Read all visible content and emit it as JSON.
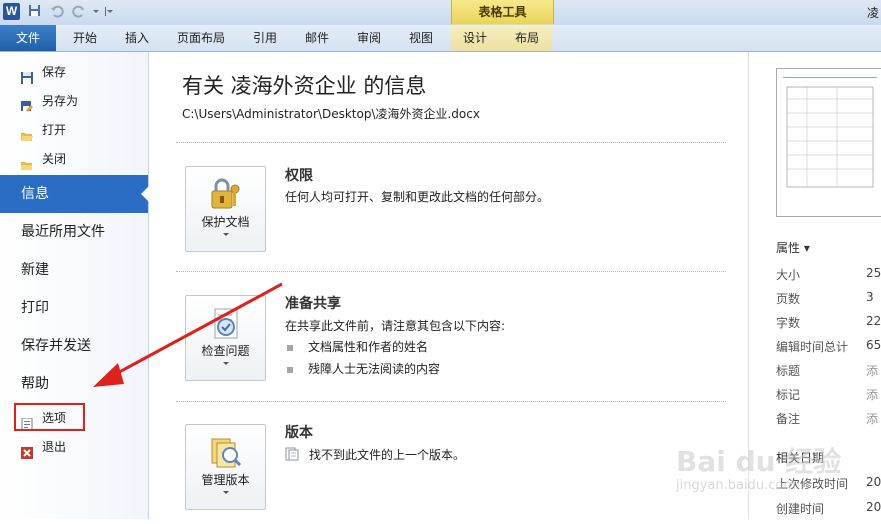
{
  "titlebar": {
    "logo": "W",
    "right_text": "凌",
    "context_group": "表格工具"
  },
  "tabs": [
    "文件",
    "开始",
    "插入",
    "页面布局",
    "引用",
    "邮件",
    "审阅",
    "视图",
    "设计",
    "布局"
  ],
  "nav": {
    "save": "保存",
    "save_as": "另存为",
    "open": "打开",
    "close": "关闭",
    "info": "信息",
    "recent": "最近所用文件",
    "new": "新建",
    "print": "打印",
    "save_send": "保存并发送",
    "help": "帮助",
    "options": "选项",
    "exit": "退出"
  },
  "main": {
    "title": "有关 凌海外资企业 的信息",
    "path": "C:\\Users\\Administrator\\Desktop\\凌海外资企业.docx",
    "permissions": {
      "button": "保护文档",
      "title": "权限",
      "desc": "任何人均可打开、复制和更改此文档的任何部分。"
    },
    "prepare": {
      "button": "检查问题",
      "title": "准备共享",
      "desc": "在共享此文件前，请注意其包含以下内容:",
      "items": [
        "文档属性和作者的姓名",
        "残障人士无法阅读的内容"
      ]
    },
    "versions": {
      "button": "管理版本",
      "title": "版本",
      "desc": "找不到此文件的上一个版本。"
    }
  },
  "right": {
    "props_header": "属性 ▾",
    "props": [
      {
        "k": "大小",
        "v": "25."
      },
      {
        "k": "页数",
        "v": "3"
      },
      {
        "k": "字数",
        "v": "22"
      },
      {
        "k": "编辑时间总计",
        "v": "65"
      },
      {
        "k": "标题",
        "v": "添"
      },
      {
        "k": "标记",
        "v": "添"
      },
      {
        "k": "备注",
        "v": "添"
      }
    ],
    "dates_header": "相关日期",
    "dates": [
      {
        "k": "上次修改时间",
        "v": "20"
      },
      {
        "k": "创建时间",
        "v": "20"
      }
    ]
  },
  "watermark": {
    "brand": "Bai du 经验",
    "url": "jingyan.baidu.com"
  },
  "colors": {
    "accent": "#2b6cc4",
    "annotation": "#e0201b"
  }
}
